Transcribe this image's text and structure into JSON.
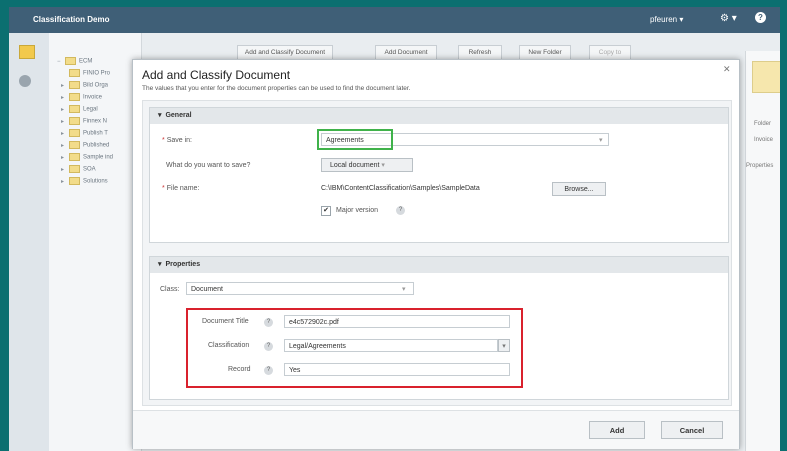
{
  "app": {
    "title": "Classification Demo",
    "user": "pfeuren ▾",
    "gear": "⚙ ▾",
    "help": "?"
  },
  "tree": {
    "root": "ECM",
    "items": [
      "FINIO Pro",
      "Bild Orga",
      "Invoice",
      "Legal",
      "Finnex N",
      "Publish T",
      "Published",
      "Sample ind",
      "SOA",
      "Solutions"
    ]
  },
  "toolbar": {
    "add_classify": "Add and Classify Document",
    "add_document": "Add Document",
    "refresh": "Refresh",
    "new_folder": "New Folder",
    "more": "Copy to"
  },
  "rightpane": {
    "t1": "Folder",
    "t2": "Invoice",
    "t3": "Properties"
  },
  "dialog": {
    "title": "Add and Classify Document",
    "subtitle": "The values that you enter for the document properties can be used to find the document later.",
    "close": "✕",
    "general": {
      "header": "General",
      "save_in_label": "Save in:",
      "save_in_value": "Agreements",
      "what_label": "What do you want to save?",
      "what_value": "Local document",
      "file_label": "File name:",
      "file_value": "C:\\IBM\\ContentClassification\\Samples\\SampleData",
      "browse": "Browse...",
      "major_label": "Major version"
    },
    "properties": {
      "header": "Properties",
      "class_label": "Class:",
      "class_value": "Document",
      "doc_title_label": "Document Title",
      "doc_title_value": "e4c572902c.pdf",
      "classification_label": "Classification",
      "classification_value": "Legal/Agreements",
      "record_label": "Record",
      "record_value": "Yes"
    },
    "buttons": {
      "add": "Add",
      "cancel": "Cancel"
    }
  },
  "icons": {
    "caret": "▾",
    "expand": "▸",
    "check": "✔",
    "help": "?"
  },
  "colors": {
    "topbar": "#3f5f77",
    "frame": "#0b6f70",
    "highlight_green": "#3fb24a",
    "highlight_red": "#d9212d"
  }
}
